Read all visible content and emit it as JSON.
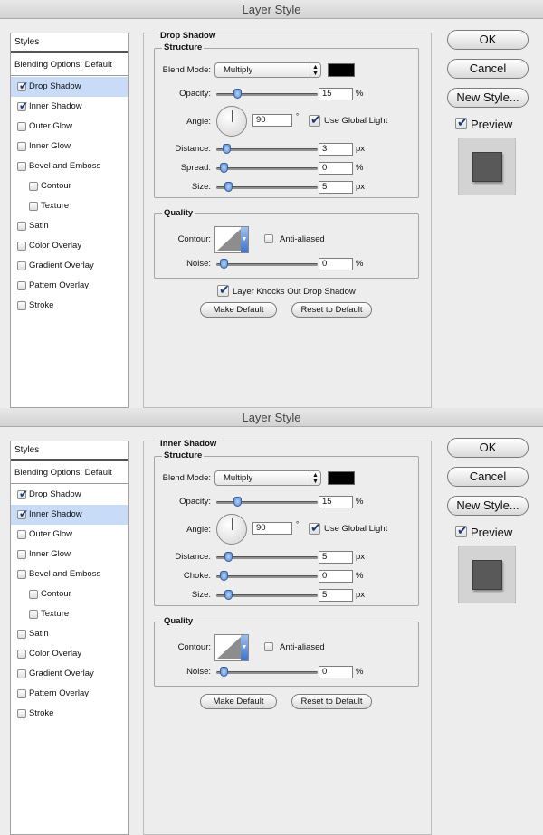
{
  "dialogs": [
    {
      "title": "Layer Style",
      "styles_header": "Styles",
      "blending_options": "Blending Options: Default",
      "items": [
        {
          "label": "Drop Shadow",
          "checked": true,
          "selected": true
        },
        {
          "label": "Inner Shadow",
          "checked": true,
          "selected": false
        },
        {
          "label": "Outer Glow",
          "checked": false,
          "selected": false
        },
        {
          "label": "Inner Glow",
          "checked": false,
          "selected": false
        },
        {
          "label": "Bevel and Emboss",
          "checked": false,
          "selected": false
        },
        {
          "label": "Contour",
          "checked": false,
          "selected": false
        },
        {
          "label": "Texture",
          "checked": false,
          "selected": false
        },
        {
          "label": "Satin",
          "checked": false,
          "selected": false
        },
        {
          "label": "Color Overlay",
          "checked": false,
          "selected": false
        },
        {
          "label": "Gradient Overlay",
          "checked": false,
          "selected": false
        },
        {
          "label": "Pattern Overlay",
          "checked": false,
          "selected": false
        },
        {
          "label": "Stroke",
          "checked": false,
          "selected": false
        }
      ],
      "section_title": "Drop Shadow",
      "structure": "Structure",
      "blend_mode_label": "Blend Mode:",
      "blend_mode_value": "Multiply",
      "shadow_color": "#000000",
      "opacity_label": "Opacity:",
      "opacity_value": "15",
      "opacity_level": 15,
      "angle_label": "Angle:",
      "angle_value": "90",
      "degree_symbol": "°",
      "use_global_light": "Use Global Light",
      "distance_label": "Distance:",
      "distance_value": "3",
      "distance_level": 3,
      "third_label": "Spread:",
      "third_value": "0",
      "third_level": 0,
      "size_label": "Size:",
      "size_value": "5",
      "size_level": 5,
      "unit_percent": "%",
      "unit_px": "px",
      "quality": "Quality",
      "contour_label": "Contour:",
      "anti_aliased": "Anti-aliased",
      "noise_label": "Noise:",
      "noise_value": "0",
      "noise_level": 0,
      "knocks_out": "Layer Knocks Out Drop Shadow",
      "make_default": "Make Default",
      "reset_default": "Reset to Default",
      "ok": "OK",
      "cancel": "Cancel",
      "new_style": "New Style...",
      "preview": "Preview"
    },
    {
      "title": "Layer Style",
      "styles_header": "Styles",
      "blending_options": "Blending Options: Default",
      "items": [
        {
          "label": "Drop Shadow",
          "checked": true,
          "selected": false
        },
        {
          "label": "Inner Shadow",
          "checked": true,
          "selected": true
        },
        {
          "label": "Outer Glow",
          "checked": false,
          "selected": false
        },
        {
          "label": "Inner Glow",
          "checked": false,
          "selected": false
        },
        {
          "label": "Bevel and Emboss",
          "checked": false,
          "selected": false
        },
        {
          "label": "Contour",
          "checked": false,
          "selected": false
        },
        {
          "label": "Texture",
          "checked": false,
          "selected": false
        },
        {
          "label": "Satin",
          "checked": false,
          "selected": false
        },
        {
          "label": "Color Overlay",
          "checked": false,
          "selected": false
        },
        {
          "label": "Gradient Overlay",
          "checked": false,
          "selected": false
        },
        {
          "label": "Pattern Overlay",
          "checked": false,
          "selected": false
        },
        {
          "label": "Stroke",
          "checked": false,
          "selected": false
        }
      ],
      "section_title": "Inner Shadow",
      "structure": "Structure",
      "blend_mode_label": "Blend Mode:",
      "blend_mode_value": "Multiply",
      "shadow_color": "#000000",
      "opacity_label": "Opacity:",
      "opacity_value": "15",
      "opacity_level": 15,
      "angle_label": "Angle:",
      "angle_value": "90",
      "degree_symbol": "°",
      "use_global_light": "Use Global Light",
      "distance_label": "Distance:",
      "distance_value": "5",
      "distance_level": 5,
      "third_label": "Choke:",
      "third_value": "0",
      "third_level": 0,
      "size_label": "Size:",
      "size_value": "5",
      "size_level": 5,
      "unit_percent": "%",
      "unit_px": "px",
      "quality": "Quality",
      "contour_label": "Contour:",
      "anti_aliased": "Anti-aliased",
      "noise_label": "Noise:",
      "noise_value": "0",
      "noise_level": 0,
      "knocks_out": "",
      "make_default": "Make Default",
      "reset_default": "Reset to Default",
      "ok": "OK",
      "cancel": "Cancel",
      "new_style": "New Style...",
      "preview": "Preview"
    }
  ]
}
